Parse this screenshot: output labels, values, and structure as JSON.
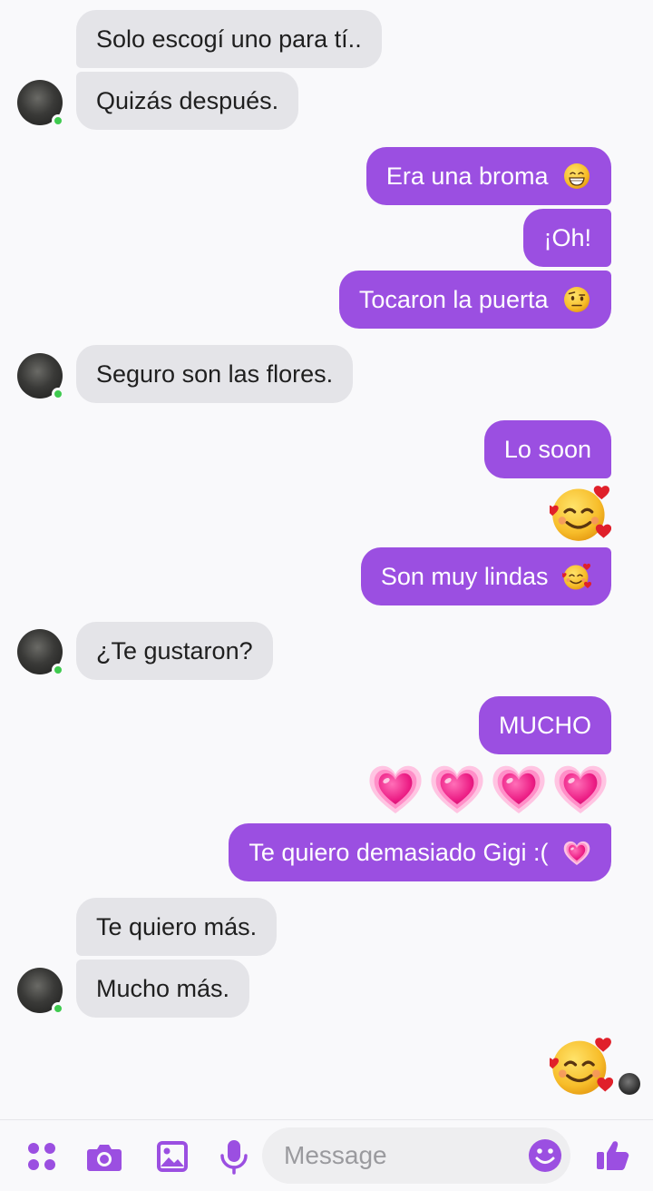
{
  "messages": [
    {
      "text": "Solo escogí uno para tí.."
    },
    {
      "text": "Quizás después."
    },
    {
      "text": "Era una broma",
      "emoji": "beaming-smile-emoji"
    },
    {
      "text": "¡Oh!"
    },
    {
      "text": "Tocaron la puerta",
      "emoji": "raised-eyebrow-emoji"
    },
    {
      "text": "Seguro son las flores."
    },
    {
      "text": "Lo soon"
    },
    {
      "text": "Son muy lindas",
      "emoji": "smiling-face-with-hearts-emoji"
    },
    {
      "text": "¿Te gustaron?"
    },
    {
      "text": "MUCHO"
    },
    {
      "text": "Te quiero demasiado Gigi :(",
      "emoji": "growing-heart-emoji"
    },
    {
      "text": "Te quiero más."
    },
    {
      "text": "Mucho más."
    }
  ],
  "composer": {
    "placeholder": "Message",
    "icons": [
      "menu-dots-icon",
      "camera-icon",
      "gallery-icon",
      "microphone-icon",
      "emoji-icon",
      "like-icon"
    ]
  },
  "colors": {
    "outgoing_bubble": "#9b4fe1",
    "incoming_bubble": "#e4e4e8",
    "online_dot": "#3fca4f",
    "accent": "#9b4fe1"
  }
}
